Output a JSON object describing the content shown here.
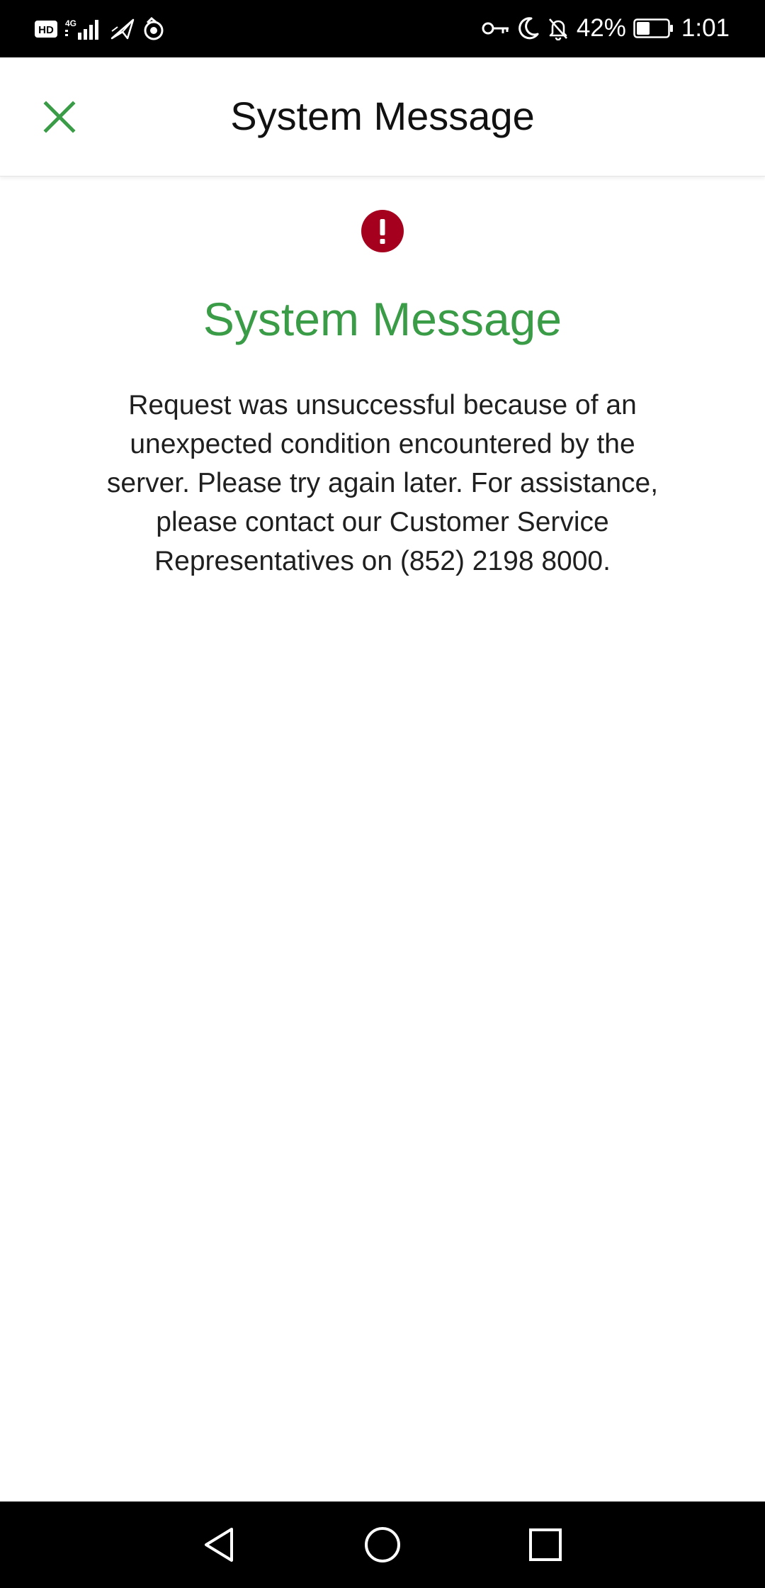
{
  "status_bar": {
    "left_icons": [
      "hd-icon",
      "4g-signal-icon",
      "airplane-notification-icon",
      "app-notification-icon"
    ],
    "hd_label": "HD",
    "network_label": "4G",
    "right_icons": [
      "vpn-key-icon",
      "do-not-disturb-moon-icon",
      "muted-bell-icon",
      "battery-icon"
    ],
    "battery_percent": "42%",
    "battery_level": 0.42,
    "time": "1:01"
  },
  "header": {
    "title": "System Message",
    "close_icon": "close-icon"
  },
  "message": {
    "icon": "alert-icon",
    "title": "System Message",
    "body": "Request was unsuccessful because of an unexpected condition encountered by the server. Please try again later. For assistance, please contact our Customer Service Representatives on (852) 2198 8000."
  },
  "nav_bar": {
    "buttons": [
      "back-icon",
      "home-icon",
      "recents-icon"
    ]
  },
  "colors": {
    "accent_green": "#3a9c47",
    "alert_red": "#a5001e",
    "status_bar_bg": "#000000",
    "nav_bar_bg": "#000000"
  }
}
